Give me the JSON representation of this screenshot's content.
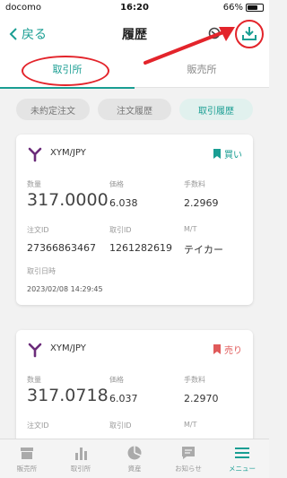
{
  "status_bar": {
    "carrier": "docomo",
    "time": "16:20",
    "battery": "66%",
    "battery_level": 0.66
  },
  "header": {
    "back_label": "戻る",
    "title": "履歴"
  },
  "tabs": [
    {
      "label": "取引所",
      "active": true
    },
    {
      "label": "販売所",
      "active": false
    }
  ],
  "filters": [
    {
      "label": "未約定注文",
      "active": false
    },
    {
      "label": "注文履歴",
      "active": false
    },
    {
      "label": "取引履歴",
      "active": true
    }
  ],
  "trades": [
    {
      "pair": "XYM/JPY",
      "side": "買い",
      "side_type": "buy",
      "quantity_label": "数量",
      "quantity": "317.0000",
      "price_label": "価格",
      "price": "6.038",
      "fee_label": "手数料",
      "fee": "2.2969",
      "order_id_label": "注文ID",
      "order_id": "27366863467",
      "trade_id_label": "取引ID",
      "trade_id": "1261282619",
      "mt_label": "M/T",
      "mt": "テイカー",
      "datetime_label": "取引日時",
      "datetime": "2023/02/08 14:29:45"
    },
    {
      "pair": "XYM/JPY",
      "side": "売り",
      "side_type": "sell",
      "quantity_label": "数量",
      "quantity": "317.0718",
      "price_label": "価格",
      "price": "6.037",
      "fee_label": "手数料",
      "fee": "2.2970",
      "order_id_label": "注文ID",
      "trade_id_label": "取引ID",
      "mt_label": "M/T"
    }
  ],
  "bottom_nav": [
    {
      "label": "販売所",
      "icon": "shop-icon",
      "active": false
    },
    {
      "label": "取引所",
      "icon": "bar-chart-icon",
      "active": false
    },
    {
      "label": "資産",
      "icon": "pie-chart-icon",
      "active": false
    },
    {
      "label": "お知らせ",
      "icon": "message-icon",
      "active": false
    },
    {
      "label": "メニュー",
      "icon": "menu-icon",
      "active": true
    }
  ],
  "colors": {
    "accent": "#1a9e93",
    "sell": "#e05a5a",
    "annotation": "#e3242b",
    "coin": "#6b2c7a"
  }
}
